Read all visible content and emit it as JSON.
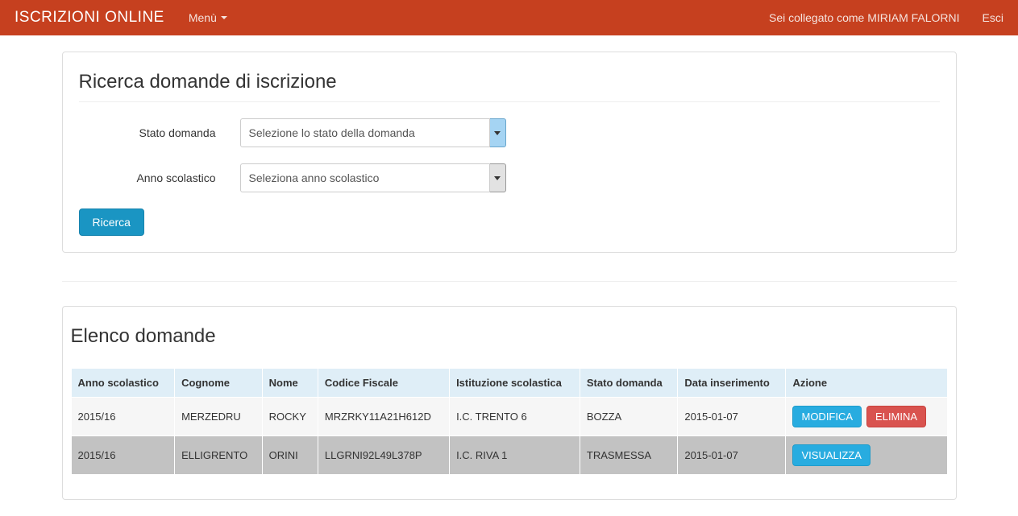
{
  "navbar": {
    "brand": "ISCRIZIONI ONLINE",
    "menu": "Menù",
    "logged_in_text": "Sei collegato come MIRIAM FALORNI",
    "logout": "Esci"
  },
  "search_panel": {
    "title": "Ricerca domande di iscrizione",
    "status_label": "Stato domanda",
    "status_placeholder": "Selezione lo stato della domanda",
    "year_label": "Anno scolastico",
    "year_placeholder": "Seleziona anno scolastico",
    "search_button": "Ricerca"
  },
  "list_panel": {
    "title": "Elenco domande",
    "headers": {
      "anno": "Anno scolastico",
      "cognome": "Cognome",
      "nome": "Nome",
      "cf": "Codice Fiscale",
      "istituzione": "Istituzione scolastica",
      "stato": "Stato domanda",
      "data": "Data inserimento",
      "azione": "Azione"
    },
    "rows": [
      {
        "anno": "2015/16",
        "cognome": "MERZEDRU",
        "nome": "ROCKY",
        "cf": "MRZRKY11A21H612D",
        "istituzione": "I.C. TRENTO 6",
        "stato": "BOZZA",
        "data": "2015-01-07",
        "actions": {
          "modifica": "MODIFICA",
          "elimina": "ELIMINA"
        }
      },
      {
        "anno": "2015/16",
        "cognome": "ELLIGRENTO",
        "nome": "ORINI",
        "cf": "LLGRNI92L49L378P",
        "istituzione": "I.C. RIVA 1",
        "stato": "TRASMESSA",
        "data": "2015-01-07",
        "actions": {
          "visualizza": "VISUALIZZA"
        }
      }
    ]
  }
}
